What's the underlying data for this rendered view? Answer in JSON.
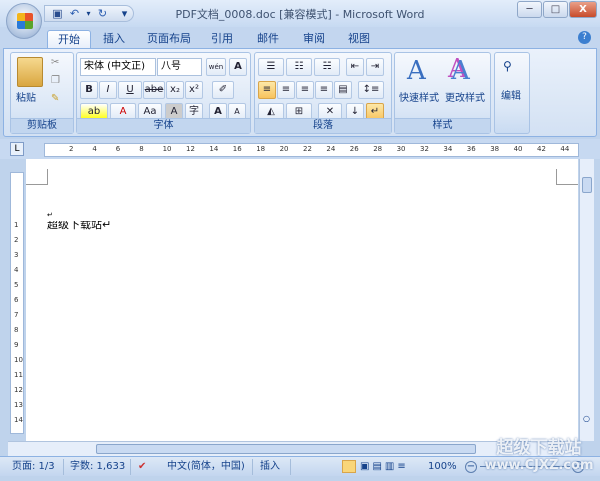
{
  "window": {
    "title": "PDF文档_0008.doc [兼容模式] - Microsoft Word",
    "minimize": "─",
    "maximize": "□",
    "close": "X"
  },
  "qat": {
    "save": "save-icon",
    "undo": "undo-icon",
    "redo": "redo-icon",
    "customize": "▾"
  },
  "tabs": [
    {
      "label": "开始",
      "active": true
    },
    {
      "label": "插入"
    },
    {
      "label": "页面布局"
    },
    {
      "label": "引用"
    },
    {
      "label": "邮件"
    },
    {
      "label": "审阅"
    },
    {
      "label": "视图"
    }
  ],
  "help": "?",
  "ribbon": {
    "clipboard": {
      "label": "剪贴板",
      "paste": "粘贴"
    },
    "font": {
      "label": "字体",
      "font_name": "宋体 (中文正)",
      "font_size": "八号",
      "bold": "B",
      "italic": "I",
      "underline": "U",
      "strike": "abe",
      "sub": "x₂",
      "sup": "x²",
      "grow": "A",
      "shrink": "A",
      "case": "Aa",
      "char_shade": "A",
      "enclose": "字",
      "phonetic": "wén"
    },
    "paragraph": {
      "label": "段落"
    },
    "styles": {
      "label": "样式",
      "quick": "快速样式",
      "change": "更改样式"
    },
    "editing": {
      "label": "编辑"
    }
  },
  "ruler": {
    "ticks": [
      "2",
      "4",
      "6",
      "8",
      "10",
      "12",
      "14",
      "16",
      "18",
      "20",
      "22",
      "24",
      "26",
      "28",
      "30",
      "32",
      "34",
      "36",
      "38",
      "40",
      "42",
      "44"
    ],
    "vticks": [
      "1",
      "2",
      "3",
      "4",
      "5",
      "6",
      "7",
      "8",
      "9",
      "10",
      "11",
      "12",
      "13",
      "14"
    ]
  },
  "document": {
    "line1": "↵",
    "line2": "超级下载站↵"
  },
  "status": {
    "page": "页面: 1/3",
    "words": "字数: 1,633",
    "language": "中文(简体，中国)",
    "mode": "插入",
    "zoom": "100%"
  },
  "watermark": {
    "line1": "超级下载站",
    "line2": "www.CJXZ.com"
  }
}
